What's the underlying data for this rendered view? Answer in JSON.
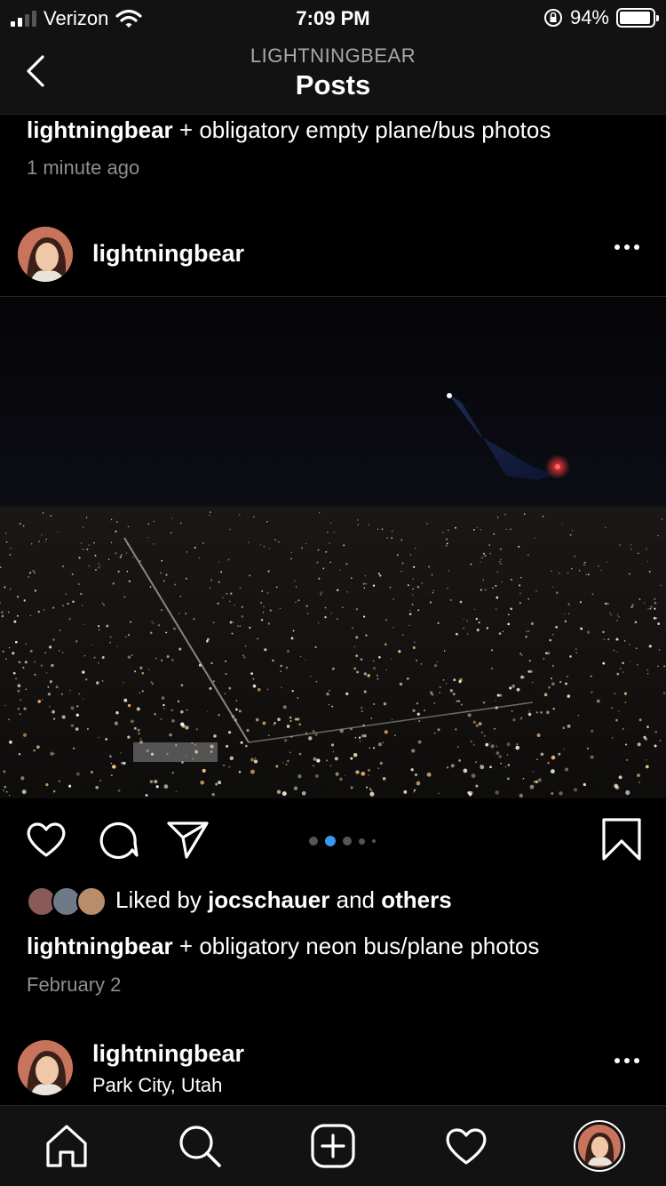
{
  "status": {
    "carrier": "Verizon",
    "time": "7:09 PM",
    "battery": "94%",
    "battery_level": 0.94
  },
  "header": {
    "subtitle": "LIGHTNINGBEAR",
    "title": "Posts"
  },
  "prev_post": {
    "username": "lightningbear",
    "caption": "+ obligatory empty plane/bus photos",
    "time": "1 minute ago"
  },
  "post": {
    "username": "lightningbear",
    "image_dots": 5,
    "active_dot": 2,
    "liked_by_prefix": "Liked by",
    "liked_by_user": "jocschauer",
    "liked_by_and": "and",
    "liked_by_others": "others",
    "caption_user": "lightningbear",
    "caption": "+ obligatory neon bus/plane photos",
    "date": "February 2"
  },
  "next_post": {
    "username": "lightningbear",
    "location": "Park City, Utah"
  },
  "colors": {
    "background": "#000000",
    "bar": "#121212",
    "accent_dot": "#3897f0",
    "muted_text": "#8e8e8e"
  },
  "icons": [
    "back-chevron-icon",
    "more-icon",
    "heart-icon",
    "comment-icon",
    "share-icon",
    "bookmark-icon",
    "home-icon",
    "search-icon",
    "add-icon",
    "activity-heart-icon"
  ]
}
